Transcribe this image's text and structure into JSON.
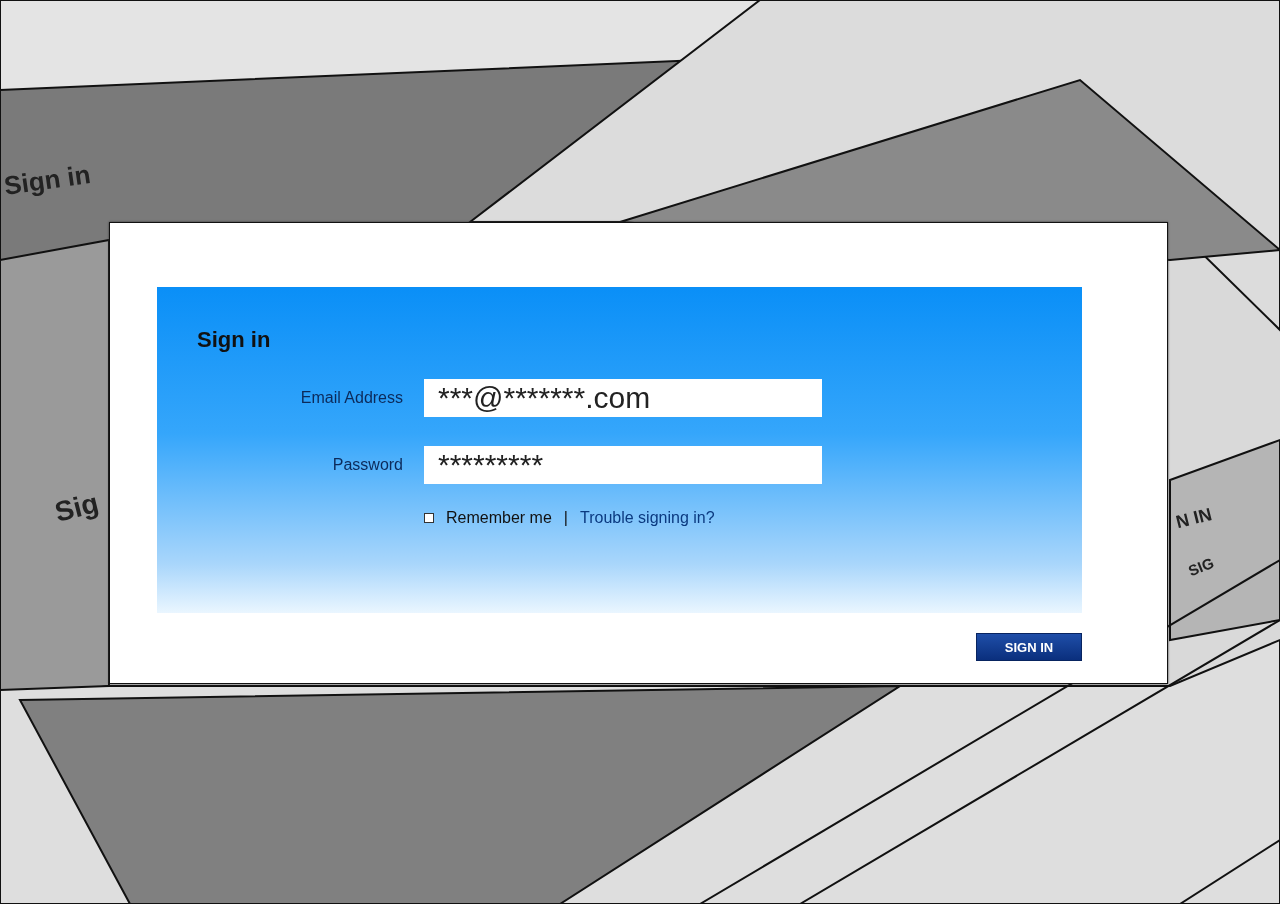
{
  "background_sheets": [
    {
      "text": "Sign in"
    },
    {
      "text": "Sig"
    },
    {
      "text": "N IN"
    },
    {
      "text": "SIG"
    }
  ],
  "form": {
    "title": "Sign in",
    "fields": [
      {
        "label": "Email Address",
        "value": "***@*******.com"
      },
      {
        "label": "Password",
        "value": "*********"
      }
    ],
    "remember": {
      "label": "Remember me",
      "checked": false
    },
    "separator": "|",
    "trouble_link": "Trouble signing in?",
    "submit": "SIGN IN"
  }
}
